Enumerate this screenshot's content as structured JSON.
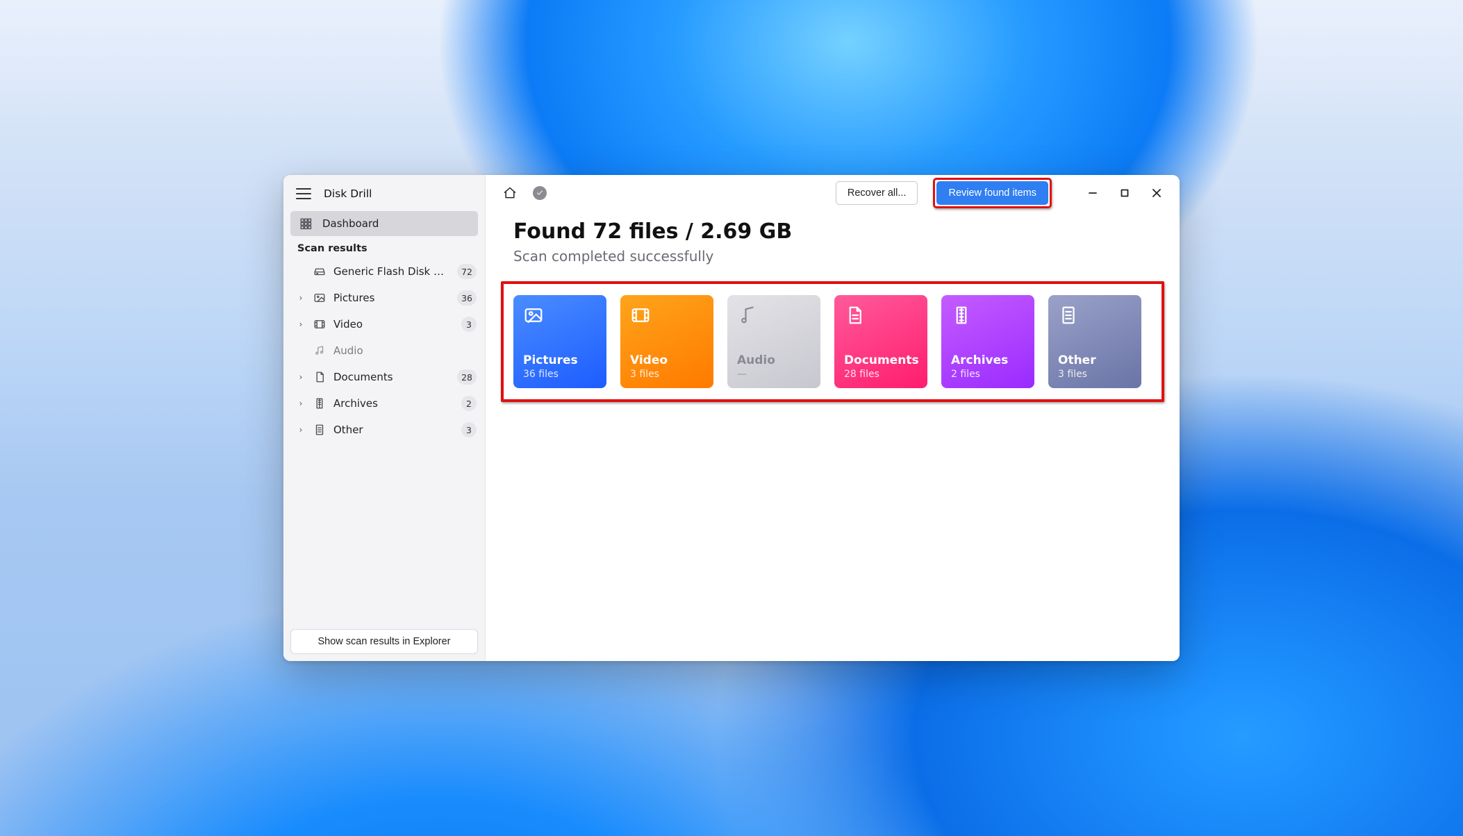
{
  "app": {
    "title": "Disk Drill"
  },
  "sidebar": {
    "dashboard_label": "Dashboard",
    "scan_results_heading": "Scan results",
    "device": {
      "label": "Generic Flash Disk USB D...",
      "count": "72"
    },
    "items": [
      {
        "key": "pictures",
        "label": "Pictures",
        "count": "36",
        "muted": false,
        "expandable": true
      },
      {
        "key": "video",
        "label": "Video",
        "count": "3",
        "muted": false,
        "expandable": true
      },
      {
        "key": "audio",
        "label": "Audio",
        "count": "",
        "muted": true,
        "expandable": false
      },
      {
        "key": "documents",
        "label": "Documents",
        "count": "28",
        "muted": false,
        "expandable": true
      },
      {
        "key": "archives",
        "label": "Archives",
        "count": "2",
        "muted": false,
        "expandable": true
      },
      {
        "key": "other",
        "label": "Other",
        "count": "3",
        "muted": false,
        "expandable": true
      }
    ],
    "explorer_button": "Show scan results in Explorer"
  },
  "toolbar": {
    "recover_all": "Recover all...",
    "review_items": "Review found items"
  },
  "summary": {
    "headline": "Found 72 files / 2.69 GB",
    "subline": "Scan completed successfully"
  },
  "cards": [
    {
      "key": "pictures",
      "label": "Pictures",
      "sub": "36 files"
    },
    {
      "key": "video",
      "label": "Video",
      "sub": "3 files"
    },
    {
      "key": "audio",
      "label": "Audio",
      "sub": "—"
    },
    {
      "key": "documents",
      "label": "Documents",
      "sub": "28 files"
    },
    {
      "key": "archives",
      "label": "Archives",
      "sub": "2 files"
    },
    {
      "key": "other",
      "label": "Other",
      "sub": "3 files"
    }
  ]
}
